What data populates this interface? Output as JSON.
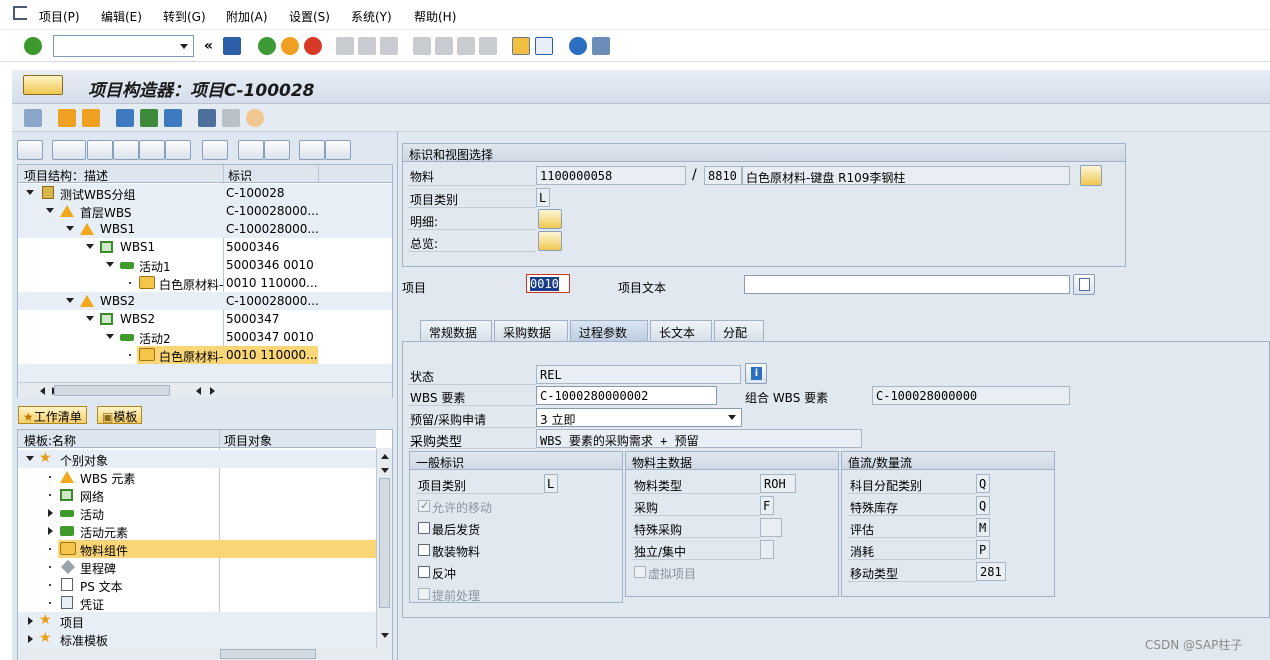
{
  "menu": [
    "项目(P)",
    "编辑(E)",
    "转到(G)",
    "附加(A)",
    "设置(S)",
    "系统(Y)",
    "帮助(H)"
  ],
  "title": "项目构造器：项目C-100028",
  "tree": {
    "headers": [
      "项目结构：描述",
      "标识"
    ],
    "rows": [
      {
        "desc": "测试WBS分组",
        "id": "C-100028"
      },
      {
        "desc": "首层WBS",
        "id": "C-100028000..."
      },
      {
        "desc": "WBS1",
        "id": "C-100028000..."
      },
      {
        "desc": "WBS1",
        "id": "5000346"
      },
      {
        "desc": "活动1",
        "id": "5000346 0010"
      },
      {
        "desc": "白色原材料-",
        "id": "0010 110000..."
      },
      {
        "desc": "WBS2",
        "id": "C-100028000..."
      },
      {
        "desc": "WBS2",
        "id": "5000347"
      },
      {
        "desc": "活动2",
        "id": "5000347 0010"
      },
      {
        "desc": "白色原材料-",
        "id": "0010 110000..."
      }
    ]
  },
  "bottom_tabs": {
    "worklist": "工作清单",
    "templates": "模板"
  },
  "templates": {
    "headers": [
      "模板:名称",
      "项目对象"
    ],
    "rows": [
      "个别对象",
      "WBS 元素",
      "网络",
      "活动",
      "活动元素",
      "物料组件",
      "里程碑",
      "PS 文本",
      "凭证",
      "项目",
      "标准模板"
    ]
  },
  "identification": {
    "group_title": "标识和视图选择",
    "material_label": "物料",
    "material_value": "1100000058",
    "plant_value": "8810",
    "material_desc": "白色原材料-键盘 R109李钢柱",
    "item_category_label": "项目类别",
    "item_category_value": "L",
    "detail_label": "明细:",
    "overview_label": "总览:",
    "separator": "/"
  },
  "item": {
    "label": "项目",
    "value": "0010",
    "text_label": "项目文本",
    "text_value": ""
  },
  "tabs": [
    "常规数据",
    "采购数据",
    "过程参数",
    "长文本",
    "分配"
  ],
  "process": {
    "status_label": "状态",
    "status_value": "REL",
    "wbs_label": "WBS 要素",
    "wbs_value": "C-1000280000002",
    "combo_wbs_label": "组合 WBS 要素",
    "combo_wbs_value": "C-100028000000",
    "reservation_label": "预留/采购申请",
    "reservation_value": "3 立即",
    "proc_type_label": "采购类型",
    "proc_type_value": "WBS 要素的采购需求 + 预留"
  },
  "general": {
    "title": "一般标识",
    "item_cat_label": "项目类别",
    "item_cat_value": "L",
    "allowed_move": "允许的移动",
    "last_issue": "最后发货",
    "bulk": "散装物料",
    "backflush": "反冲",
    "advance": "提前处理"
  },
  "material_master": {
    "title": "物料主数据",
    "mat_type_label": "物料类型",
    "mat_type_value": "ROH",
    "procurement_label": "采购",
    "procurement_value": "F",
    "special_proc_label": "特殊采购",
    "special_proc_value": "",
    "indiv_coll_label": "独立/集中",
    "indiv_coll_value": "",
    "phantom": "虚拟项目"
  },
  "value_flow": {
    "title": "值流/数量流",
    "acct_assign_label": "科目分配类别",
    "acct_assign_value": "Q",
    "special_stock_label": "特殊库存",
    "special_stock_value": "Q",
    "valuation_label": "评估",
    "valuation_value": "M",
    "consumption_label": "消耗",
    "consumption_value": "P",
    "movement_type_label": "移动类型",
    "movement_type_value": "281"
  },
  "watermark": "CSDN @SAP柱子"
}
